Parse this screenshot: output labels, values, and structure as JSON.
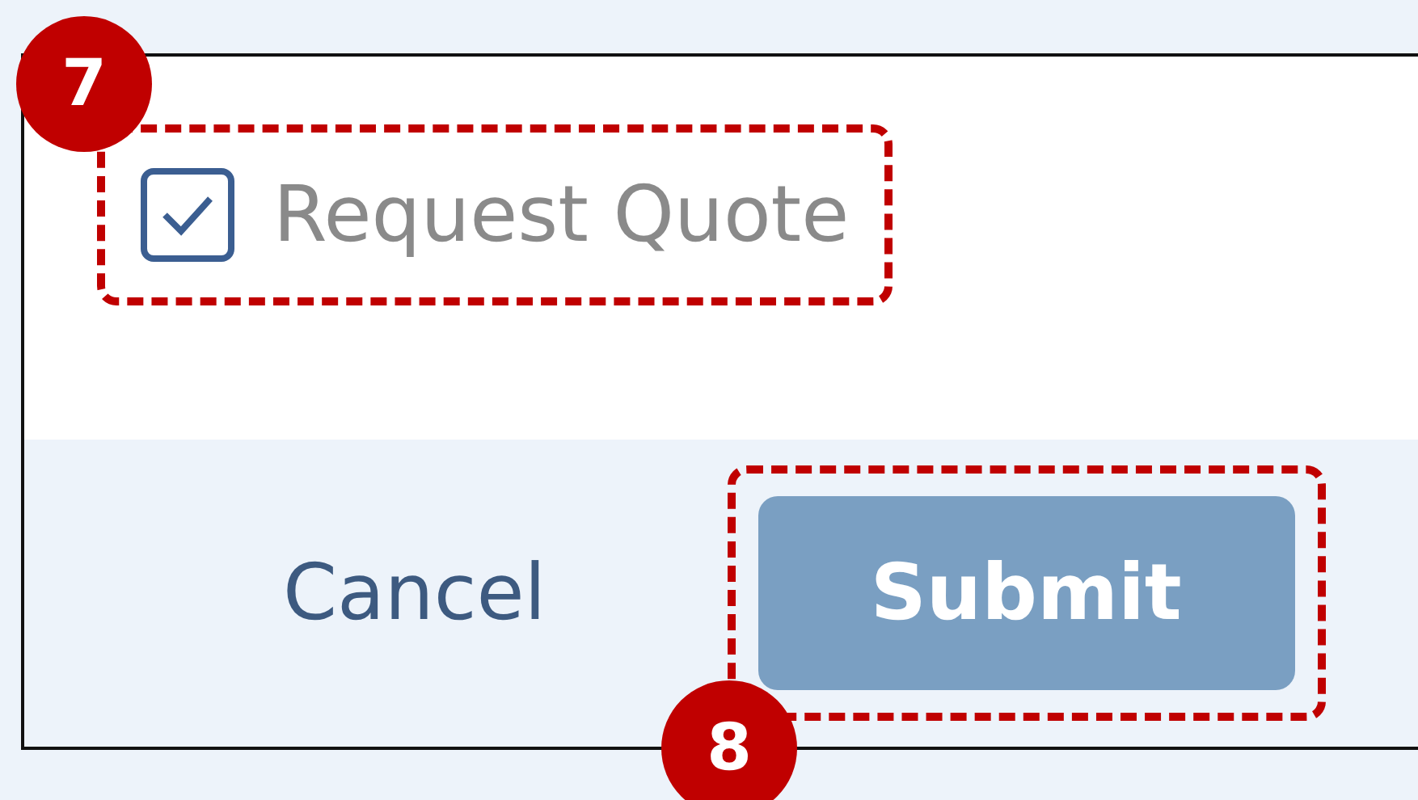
{
  "callouts": [
    {
      "number": "7"
    },
    {
      "number": "8"
    }
  ],
  "checkbox": {
    "label": "Request Quote",
    "checked": true
  },
  "buttons": [
    {
      "label": "Cancel",
      "kind": "link",
      "disabled": false
    },
    {
      "label": "Submit",
      "kind": "primary",
      "disabled": true
    }
  ]
}
